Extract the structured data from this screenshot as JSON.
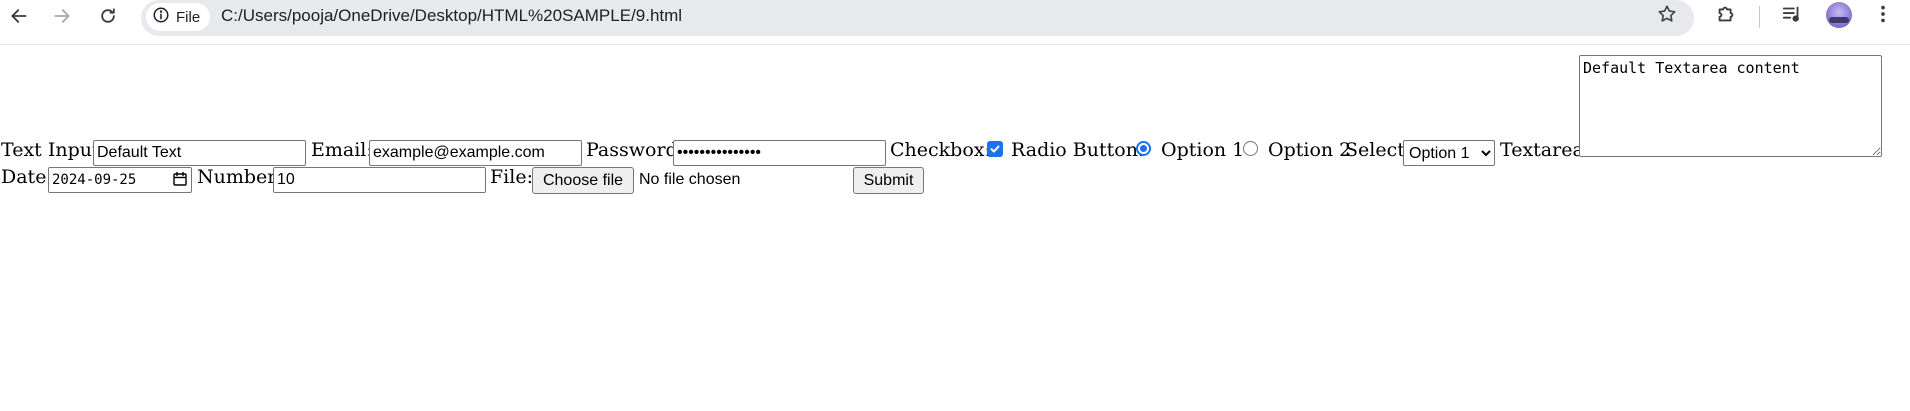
{
  "browser": {
    "site_chip_label": "File",
    "url": "C:/Users/pooja/OneDrive/Desktop/HTML%20SAMPLE/9.html",
    "icons": [
      "back-arrow-icon",
      "forward-arrow-icon",
      "reload-icon",
      "info-icon",
      "star-icon",
      "extensions-icon",
      "media-queue-icon",
      "avatar",
      "more-menu-icon"
    ]
  },
  "form": {
    "text_input_label": "Text Input:",
    "text_input_value": "Default Text",
    "email_label": "Email:",
    "email_value": "example@example.com",
    "password_label": "Password:",
    "password_masked": "•••••••••••••••",
    "checkbox_label": "Checkbox:",
    "checkbox_checked": true,
    "radio_label": "Radio Button:",
    "radio_option1": "Option 1",
    "radio_option2": "Option 2",
    "radio_selected": "Option 1",
    "select_label": "Select:",
    "select_value": "Option 1",
    "textarea_label": "Textarea:",
    "textarea_value": "Default Textarea content",
    "date_label": "Date:",
    "date_value": "2024-09-25",
    "number_label": "Number:",
    "number_value": "10",
    "file_label": "File:",
    "file_button": "Choose file",
    "file_status": "No file chosen",
    "submit_label": "Submit"
  },
  "colors": {
    "accent": "#1a73e8",
    "omnibox_bg": "#e8e9ec"
  }
}
